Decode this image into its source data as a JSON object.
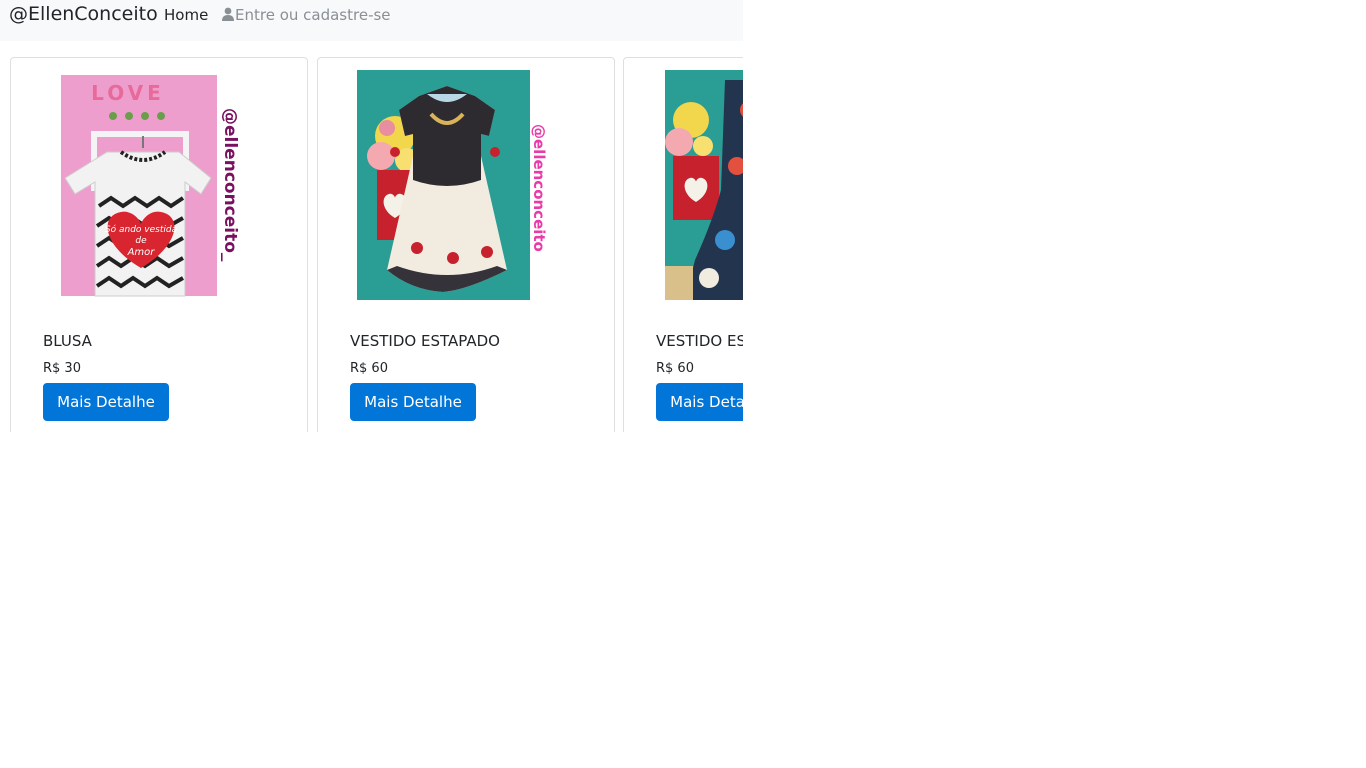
{
  "navbar": {
    "brand": "@EllenConceito",
    "home": "Home",
    "login": "Entre ou cadastre-se",
    "login_icon": "user-icon"
  },
  "products": [
    {
      "title": "BLUSA",
      "price": "R$ 30",
      "button": "Mais Detalhe",
      "watermark": "@ellenconceito_",
      "sign_text": "LOVE",
      "shirt_text_1": "Só ando vestida",
      "shirt_text_2": "de",
      "shirt_text_3": "Amor"
    },
    {
      "title": "VESTIDO ESTAPADO",
      "price": "R$ 60",
      "button": "Mais Detalhe",
      "watermark": "@ellenconceito"
    },
    {
      "title": "VESTIDO ESTAPADO",
      "price": "R$ 60",
      "button": "Mais Detalhe"
    }
  ],
  "colors": {
    "primary": "#0275d8",
    "navbar_bg": "#f8f9fa",
    "teal": "#2a9d94",
    "pink": "#ee9ecc"
  }
}
